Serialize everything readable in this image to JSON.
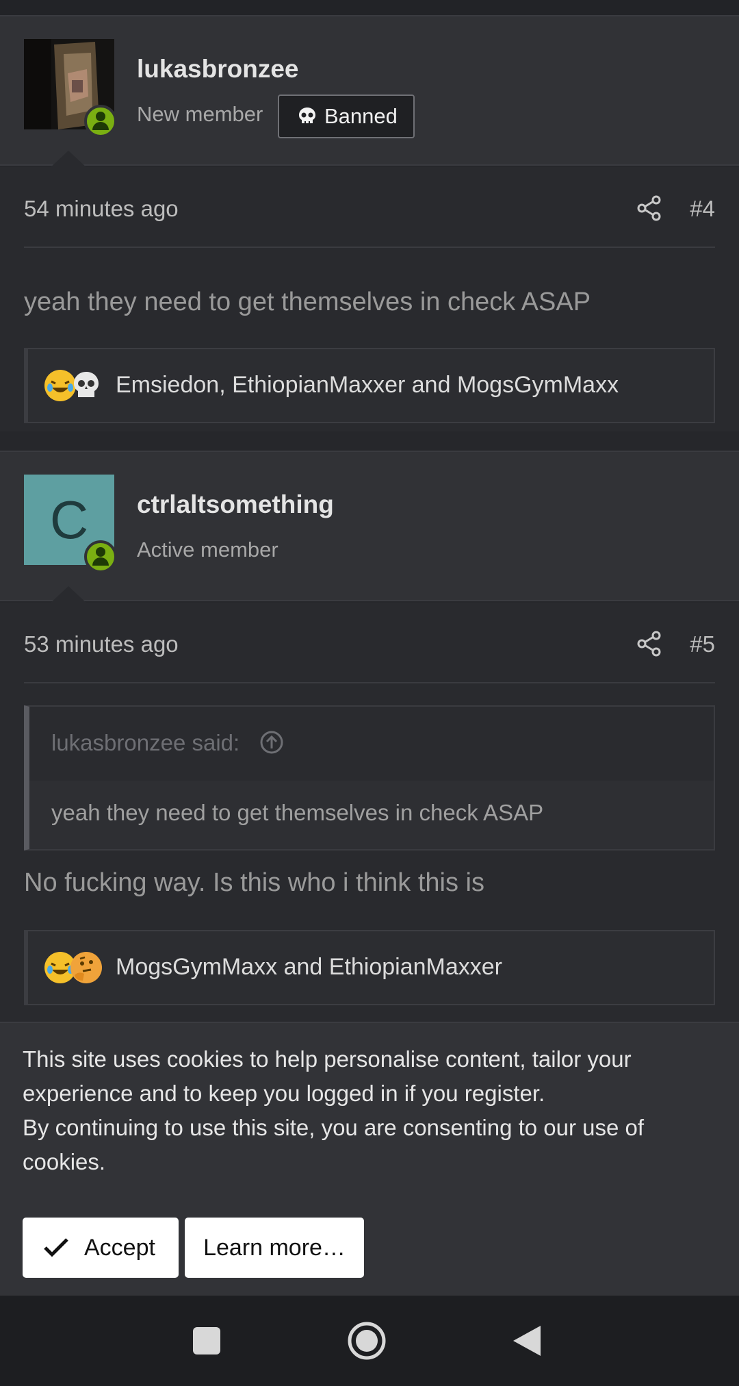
{
  "posts": [
    {
      "username": "lukasbronzee",
      "user_title": "New member",
      "badge": "Banned",
      "timestamp": "54 minutes ago",
      "post_number": "#4",
      "message": "yeah they need to get themselves in check ASAP",
      "reactions": {
        "icons": [
          "laughing-crying-emoji-icon",
          "skull-emoji-icon"
        ],
        "users": "Emsiedon, EthiopianMaxxer and MogsGymMaxx"
      }
    },
    {
      "username": "ctrlaltsomething",
      "avatar_letter": "C",
      "user_title": "Active member",
      "timestamp": "53 minutes ago",
      "post_number": "#5",
      "quote": {
        "author": "lukasbronzee said:",
        "text": "yeah they need to get themselves in check ASAP"
      },
      "message": "No fucking way. Is this who i think this is",
      "reactions": {
        "icons": [
          "laughing-crying-emoji-icon",
          "thinking-emoji-icon"
        ],
        "users": "MogsGymMaxx and EthiopianMaxxer"
      }
    }
  ],
  "cookie_notice": {
    "line1": "This site uses cookies to help personalise content, tailor your experience and to keep you logged in if you register.",
    "line2": "By continuing to use this site, you are consenting to our use of cookies.",
    "accept_label": "Accept",
    "learn_more_label": "Learn more…"
  },
  "colors": {
    "background": "#26272b",
    "online_indicator": "#7aaf12",
    "avatar_c": "#5e9fa1"
  }
}
